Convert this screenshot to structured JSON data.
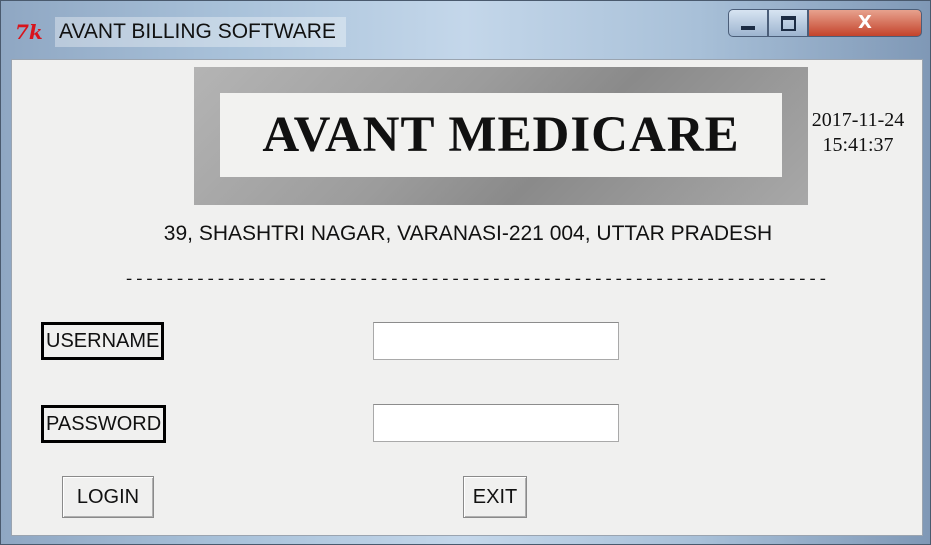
{
  "window": {
    "title": "AVANT BILLING SOFTWARE",
    "icon": "tk-feather-icon",
    "controls": {
      "minimize": "minimize-icon",
      "maximize": "maximize-icon",
      "close": "X"
    }
  },
  "banner": {
    "title": "AVANT MEDICARE"
  },
  "clock": {
    "date": "2017-11-24",
    "time": "15:41:37"
  },
  "address": "39, SHASHTRI NAGAR, VARANASI-221 004, UTTAR PRADESH",
  "divider": "------------------------------------------------------------------------------",
  "form": {
    "username_label": "USERNAME",
    "username_value": "",
    "password_label": "PASSWORD",
    "password_value": ""
  },
  "buttons": {
    "login": "LOGIN",
    "exit": "EXIT"
  },
  "colors": {
    "icon_red": "#d8141c",
    "banner_frame": "#9c9c9c",
    "panel_bg": "#f0f0ef",
    "close_button": "#c4432b"
  }
}
